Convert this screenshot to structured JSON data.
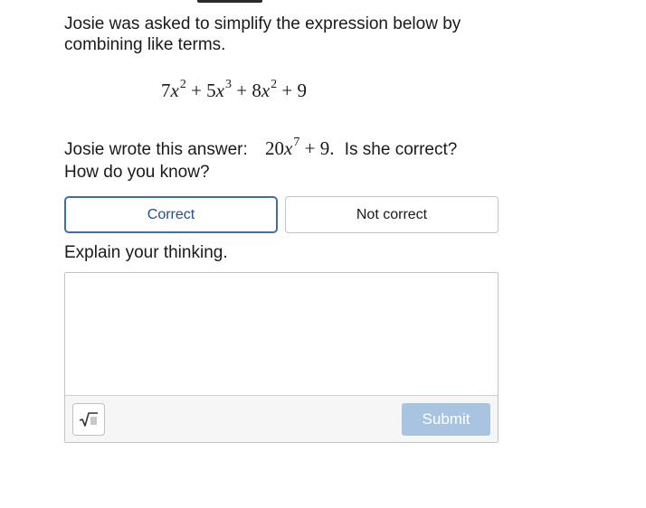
{
  "question": {
    "prompt": "Josie was asked to simplify the expression below by combining like terms.",
    "expression": {
      "t1_coef": "7",
      "t1_var": "x",
      "t1_exp": "2",
      "op1": "+",
      "t2_coef": "5",
      "t2_var": "x",
      "t2_exp": "3",
      "op2": "+",
      "t3_coef": "8",
      "t3_var": "x",
      "t3_exp": "2",
      "op3": "+",
      "t4": "9"
    },
    "answer_prefix": "Josie wrote this answer:",
    "answer_expression": {
      "coef": "20",
      "var": "x",
      "exp": "7",
      "op": "+",
      "const": "9",
      "end": "."
    },
    "answer_suffix": "Is she correct?",
    "followup": "How do you know?"
  },
  "choices": [
    {
      "label": "Correct",
      "selected": true
    },
    {
      "label": "Not correct",
      "selected": false
    }
  ],
  "explain": {
    "label": "Explain your thinking.",
    "value": "",
    "math_button_icon": "square-root-icon",
    "submit_label": "Submit",
    "submit_color": "#a9c4e0"
  },
  "colors": {
    "selected_border": "#3f6fa6",
    "selected_text": "#1f4f86"
  }
}
